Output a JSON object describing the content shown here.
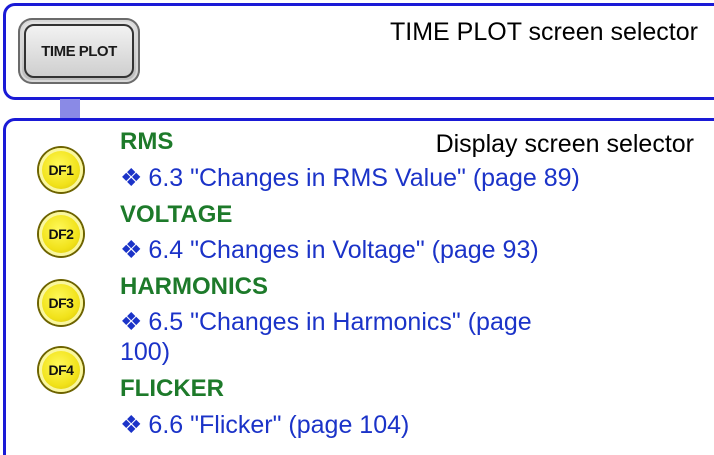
{
  "header": {
    "key_label": "TIME PLOT",
    "title": "TIME PLOT screen selector"
  },
  "display_selector_title": "Display screen selector",
  "keys": [
    {
      "label": "DF1"
    },
    {
      "label": "DF2"
    },
    {
      "label": "DF3"
    },
    {
      "label": "DF4"
    }
  ],
  "entries": [
    {
      "title": "RMS",
      "bullet": "❖",
      "link": "6.3 \"Changes in RMS Value\" (page 89)"
    },
    {
      "title": "VOLTAGE",
      "bullet": "❖",
      "link": "6.4 \"Changes in Voltage\" (page 93)"
    },
    {
      "title": "HARMONICS",
      "bullet": "❖",
      "link": "6.5 \"Changes in Harmonics\" (page 100)"
    },
    {
      "title": "FLICKER",
      "bullet": "❖",
      "link": "6.6 \"Flicker\" (page 104)"
    }
  ],
  "colors": {
    "frame": "#1a1ad6",
    "title_green": "#1d7a2a",
    "link_blue": "#1b33c8",
    "key_yellow": "#f1e21a"
  }
}
